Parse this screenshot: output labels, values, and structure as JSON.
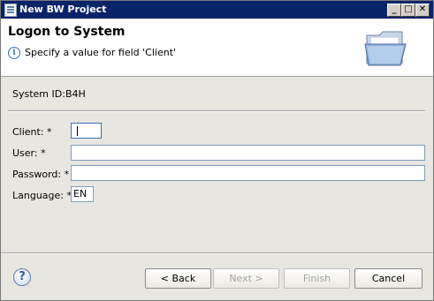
{
  "window": {
    "title": "New BW Project"
  },
  "header": {
    "title": "Logon to System",
    "message": "Specify a value for field 'Client'"
  },
  "form": {
    "system_id_label": "System ID:",
    "system_id_value": "B4H",
    "client_label": "Client: *",
    "client_value": "",
    "user_label": "User: *",
    "user_value": "",
    "password_label": "Password: *",
    "password_value": "",
    "language_label": "Language: *",
    "language_value": "EN"
  },
  "footer": {
    "help": "?",
    "back_label": "< Back",
    "next_label": "Next >",
    "finish_label": "Finish",
    "cancel_label": "Cancel"
  },
  "colors": {
    "titlebar": "#0a246a",
    "header_bg": "#ffffff",
    "dialog_bg": "#e8e6e1"
  }
}
